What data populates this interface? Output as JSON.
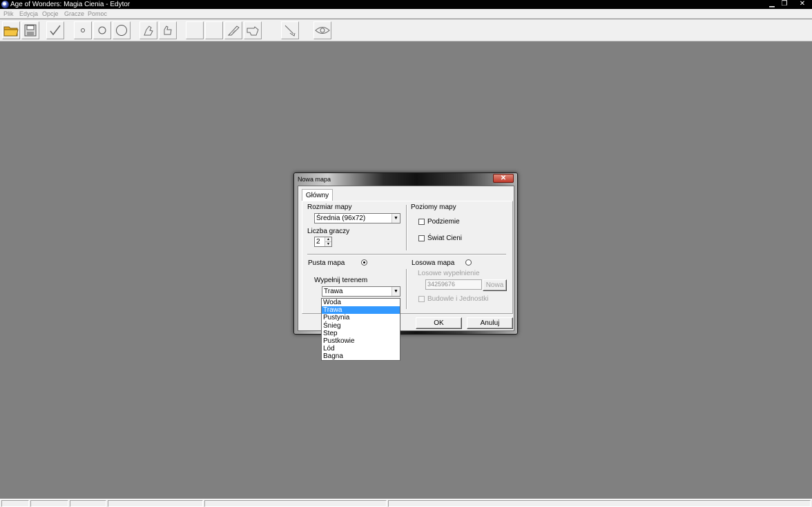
{
  "window": {
    "title": "Age of Wonders: Magia Cienia - Edytor",
    "minimize_glyph": "▁",
    "restore_glyph": "❐",
    "close_glyph": "✕"
  },
  "menu": [
    "Plik",
    "Edycja",
    "Opcje",
    "Gracze",
    "Pomoc"
  ],
  "toolbar": {
    "icons": [
      "open-folder-icon",
      "save-disk-icon",
      "check-icon",
      "brush-small-icon",
      "brush-medium-icon",
      "brush-large-icon",
      "terrain-up-icon",
      "terrain-hand-icon",
      "blank-tool-1",
      "blank-tool-2",
      "feather-icon",
      "pointing-hand-icon",
      "wand-icon",
      "eye-icon"
    ]
  },
  "dialog": {
    "title": "Nowa mapa",
    "close_glyph": "✕",
    "tab": "Główny",
    "map_size": {
      "label": "Rozmiar mapy",
      "value": "Średnia (96x72)"
    },
    "players": {
      "label": "Liczba graczy",
      "value": "2"
    },
    "levels": {
      "label": "Poziomy mapy",
      "underground": "Podziemie",
      "shadow_world": "Świat Cieni"
    },
    "empty_map": {
      "label": "Pusta mapa",
      "selected": true
    },
    "random_map": {
      "label": "Losowa mapa",
      "selected": false
    },
    "fill_terrain": {
      "label": "Wypełnij terenem",
      "value": "Trawa"
    },
    "random_fill": {
      "label": "Losowe wypełnienie",
      "seed": "34259676",
      "new_button": "Nowa"
    },
    "buildings_units": "Budowle i Jednostki",
    "ok": "OK",
    "cancel": "Anuluj"
  },
  "dropdown": {
    "options": [
      "Woda",
      "Trawa",
      "Pustynia",
      "Śnieg",
      "Step",
      "Pustkowie",
      "Lód",
      "Bagna"
    ],
    "selected_index": 1
  },
  "arrow_glyph": "▼",
  "spin_up_glyph": "▲",
  "spin_down_glyph": "▼"
}
